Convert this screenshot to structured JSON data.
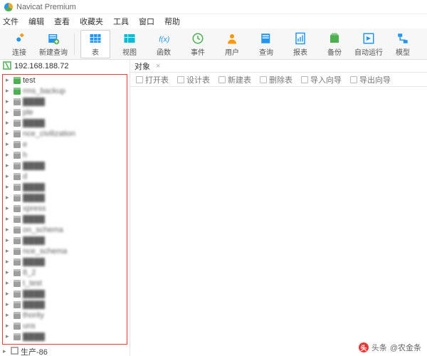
{
  "window": {
    "title": "Navicat Premium"
  },
  "menu": [
    "文件",
    "编辑",
    "查看",
    "收藏夹",
    "工具",
    "窗口",
    "帮助"
  ],
  "toolbar": [
    {
      "id": "connect",
      "label": "连接"
    },
    {
      "id": "new-query",
      "label": "新建查询"
    },
    {
      "id": "table",
      "label": "表",
      "active": true
    },
    {
      "id": "view",
      "label": "视图"
    },
    {
      "id": "function",
      "label": "函数"
    },
    {
      "id": "event",
      "label": "事件"
    },
    {
      "id": "user",
      "label": "用户"
    },
    {
      "id": "query",
      "label": "查询"
    },
    {
      "id": "report",
      "label": "报表"
    },
    {
      "id": "backup",
      "label": "备份"
    },
    {
      "id": "automation",
      "label": "自动运行"
    },
    {
      "id": "model",
      "label": "模型"
    }
  ],
  "connection": {
    "host": "192.168.188.72"
  },
  "databases": [
    {
      "name": "test",
      "green": true
    },
    {
      "name": "rms_backup",
      "blur": true,
      "green": true
    },
    {
      "name": "",
      "blur": true
    },
    {
      "name": "ple",
      "blur": true
    },
    {
      "name": "",
      "blur": true
    },
    {
      "name": "nce_civilization",
      "blur": true
    },
    {
      "name": "e",
      "blur": true
    },
    {
      "name": "h",
      "blur": true
    },
    {
      "name": "",
      "blur": true
    },
    {
      "name": "d",
      "blur": true
    },
    {
      "name": "",
      "blur": true
    },
    {
      "name": "",
      "blur": true
    },
    {
      "name": "xpress",
      "blur": true
    },
    {
      "name": "",
      "blur": true
    },
    {
      "name": "on_schema",
      "blur": true
    },
    {
      "name": "",
      "blur": true
    },
    {
      "name": "nce_schema",
      "blur": true
    },
    {
      "name": "",
      "blur": true
    },
    {
      "name": "8_2",
      "blur": true
    },
    {
      "name": "t_test",
      "blur": true
    },
    {
      "name": "",
      "blur": true
    },
    {
      "name": "",
      "blur": true
    },
    {
      "name": "thority",
      "blur": true
    },
    {
      "name": "uns",
      "blur": true
    },
    {
      "name": "",
      "blur": true
    }
  ],
  "extra_node": {
    "name": "生产-86"
  },
  "tab": {
    "label": "对象"
  },
  "objectbar": [
    "打开表",
    "设计表",
    "新建表",
    "删除表",
    "导入向导",
    "导出向导"
  ],
  "watermark": {
    "label": "头条",
    "author": "@农金条"
  }
}
